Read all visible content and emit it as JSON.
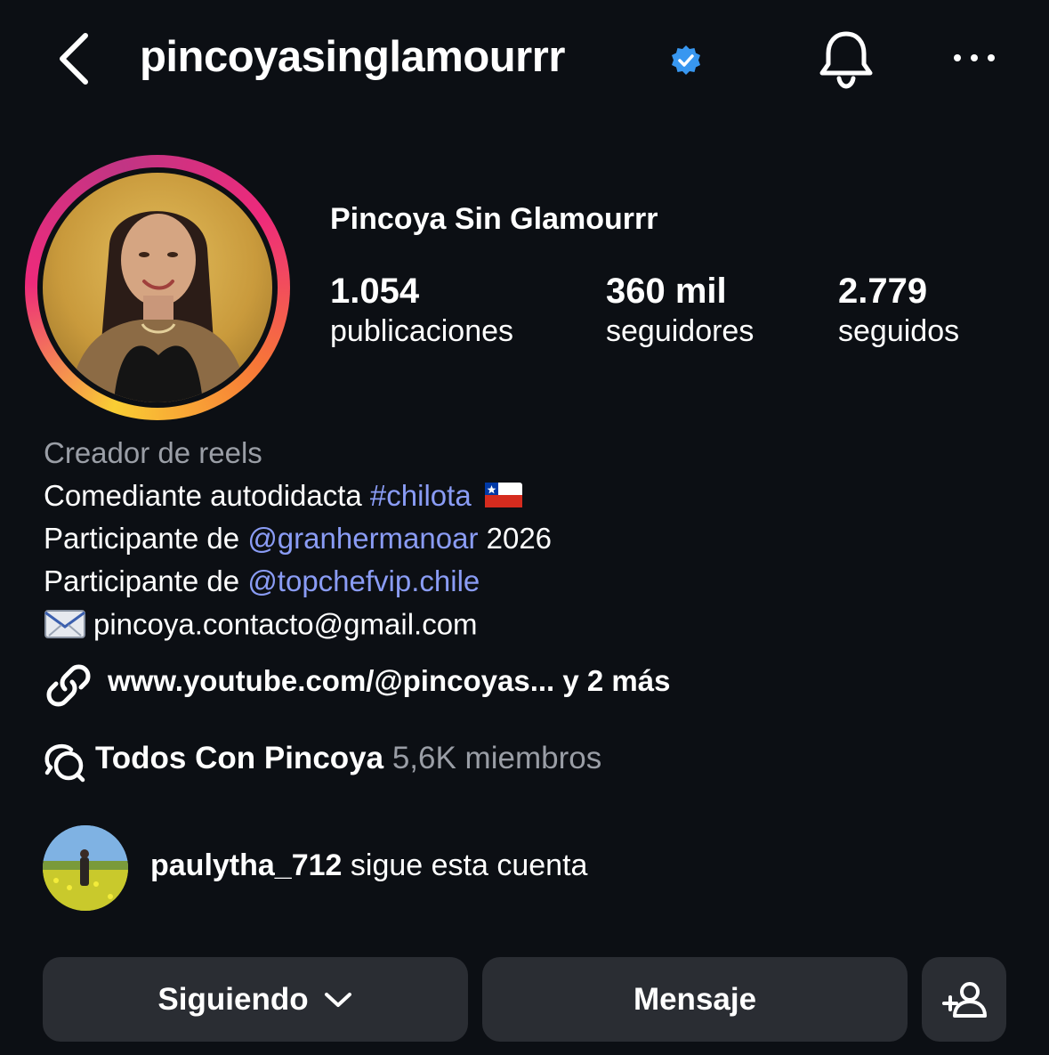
{
  "header": {
    "username": "pincoyasinglamourrr",
    "verified_color": "#3897f0"
  },
  "profile": {
    "display_name": "Pincoya Sin Glamourrr",
    "stats": [
      {
        "value": "1.054",
        "label": "publicaciones"
      },
      {
        "value": "360 mil",
        "label": "seguidores"
      },
      {
        "value": "2.779",
        "label": "seguidos"
      }
    ]
  },
  "bio": {
    "category": "Creador de reels",
    "line1_text": "Comediante autodidacta ",
    "line1_hashtag": "#chilota",
    "line2_prefix": "Participante de ",
    "line2_mention": "@granhermanoar",
    "line2_suffix": " 2026",
    "line3_prefix": "Participante de ",
    "line3_mention": "@topchefvip.chile",
    "email": "pincoya.contacto@gmail.com",
    "link_text": "www.youtube.com/@pincoyas...  y 2 más"
  },
  "channel": {
    "name": "Todos Con Pincoya",
    "members": "5,6K miembros"
  },
  "followed_by": {
    "username": "paulytha_712",
    "text": " sigue esta cuenta"
  },
  "actions": {
    "following_label": "Siguiendo",
    "message_label": "Mensaje"
  },
  "colors": {
    "background": "#0c0f14",
    "link_blue": "#8a9cf5",
    "secondary_text": "#9a9ea6",
    "button_bg": "#2a2d33"
  }
}
